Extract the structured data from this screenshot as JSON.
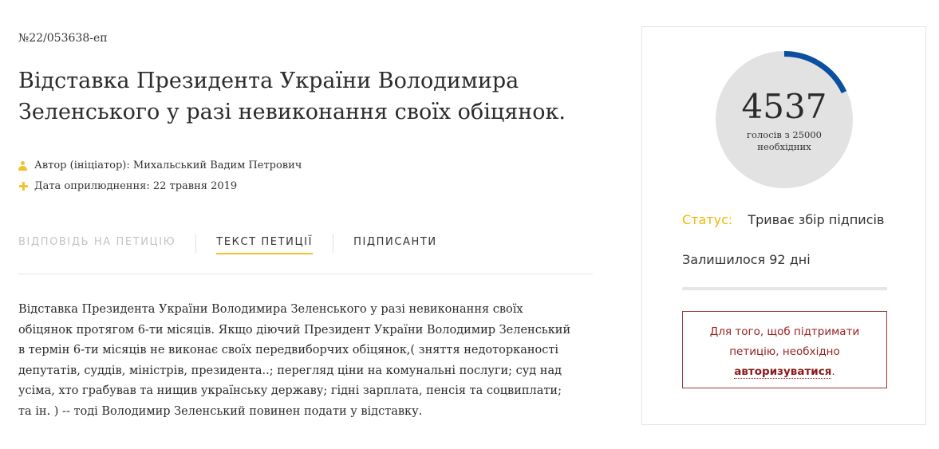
{
  "petition": {
    "number": "№22/053638-еп",
    "title": "Відставка Президента України Володимира Зеленського у разі невиконання своїх обіцянок.",
    "author_label": "Автор (ініціатор): Михальський Вадим Петрович",
    "date_label": "Дата оприлюднення: 22 травня 2019",
    "icons": {
      "author": "user-icon",
      "date": "plus-icon"
    },
    "accent_color": "#f2c12e",
    "text": "Відставка Президента України Володимира Зеленського у разі невиконання своїх обіцянок протягом 6-ти місяців. Якщо діючий Президент України Володимир Зеленський в термін 6-ти місяців не виконає своїх передвиборчих обіцянок,( зняття недоторканості депутатів, суддів, міністрів, президента..; перегляд ціни на комунальні послуги; суд над усіма, хто грабував та нищив українську державу; гідні зарплата, пенсія та соцвиплати; та ін. ) -- тоді Володимир Зеленський повинен подати у відставку."
  },
  "tabs": [
    {
      "label": "Відповідь на петицію",
      "state": "disabled"
    },
    {
      "label": "Текст петиції",
      "state": "active"
    },
    {
      "label": "Підписанти",
      "state": "normal"
    }
  ],
  "sidebar": {
    "votes": "4537",
    "votes_caption": "голосів з 25000 необхідних",
    "votes_required": 25000,
    "progress_fraction": 0.18148,
    "ring_color": "#0b4fa0",
    "status_label": "Статус:",
    "status_value": "Триває збір підписів",
    "remaining": "Залишилося 92 дні",
    "notice_text": "Для того, щоб підтримати петицію, необхідно",
    "notice_link": "авторизуватися",
    "notice_end": "."
  }
}
